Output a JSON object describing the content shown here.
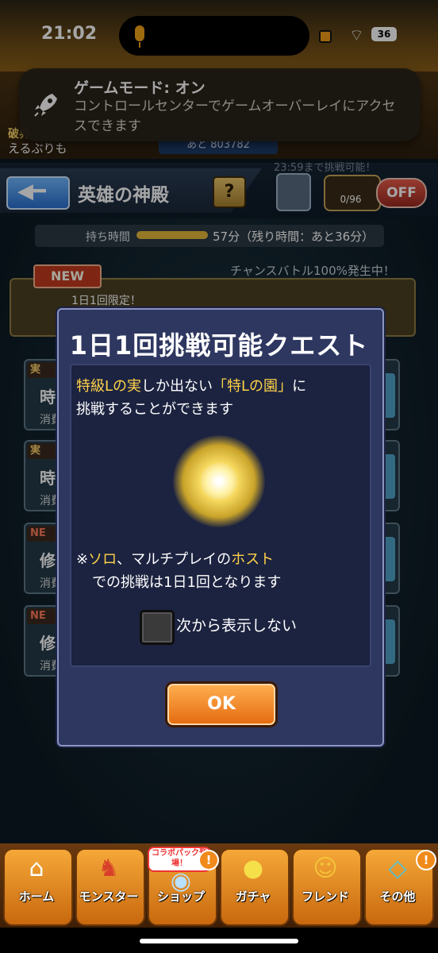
{
  "status_bar": {
    "time": "21:02",
    "battery": "36"
  },
  "notification": {
    "title": "ゲームモード: オン",
    "body": "コントロールセンターでゲームオーバーレイにアクセスできます"
  },
  "header": {
    "rank_label": "破界",
    "player_name": "えるぶりも",
    "exp_remaining": "あと 803782",
    "page_title": "英雄の神殿",
    "help_label": "?",
    "stamina": "0/96",
    "toggle_label": "OFF",
    "deadline": "23:59まで挑戦可能！"
  },
  "background_list": {
    "timer_label": "持ち時間",
    "timer_value": "57分（残り時間：あと36分）",
    "chance_text": "チャンスバトル100%発生中！",
    "new_badge": "NEW",
    "limited_text": "1日1回限定！",
    "cards": [
      {
        "tag": "実",
        "char": "時",
        "cost": "消費"
      },
      {
        "tag": "実",
        "char": "時",
        "cost": "消費"
      },
      {
        "tag": "NE",
        "char": "修",
        "cost": "消費"
      },
      {
        "tag": "NE",
        "char": "修",
        "cost": "消費"
      }
    ]
  },
  "dialog": {
    "title": "1日1回挑戦可能クエスト",
    "desc1_a": "特級Lの実",
    "desc1_b": "しか出ない",
    "desc1_c": "「特Lの園」",
    "desc1_d": "に",
    "desc2": "挑戦することができます",
    "note1_a": "※",
    "note1_b": "ソロ",
    "note1_c": "、マルチプレイの",
    "note1_d": "ホスト",
    "note2": "での挑戦は1日1回となります",
    "checkbox_label": "次から表示しない",
    "ok_label": "OK"
  },
  "bottom_nav": {
    "items": [
      {
        "label": "ホーム",
        "icon": "home-icon"
      },
      {
        "label": "モンスター",
        "icon": "monster-icon"
      },
      {
        "label": "ショップ",
        "icon": "shop-icon"
      },
      {
        "label": "ガチャ",
        "icon": "gacha-icon"
      },
      {
        "label": "フレンド",
        "icon": "friend-icon"
      },
      {
        "label": "その他",
        "icon": "other-icon"
      }
    ],
    "collab_badge": "コラボパック登場！",
    "alert": "!"
  },
  "colors": {
    "accent_yellow": "#ffd24a",
    "ok_orange": "#e46a0e",
    "dialog_bg": "#2e3760"
  }
}
